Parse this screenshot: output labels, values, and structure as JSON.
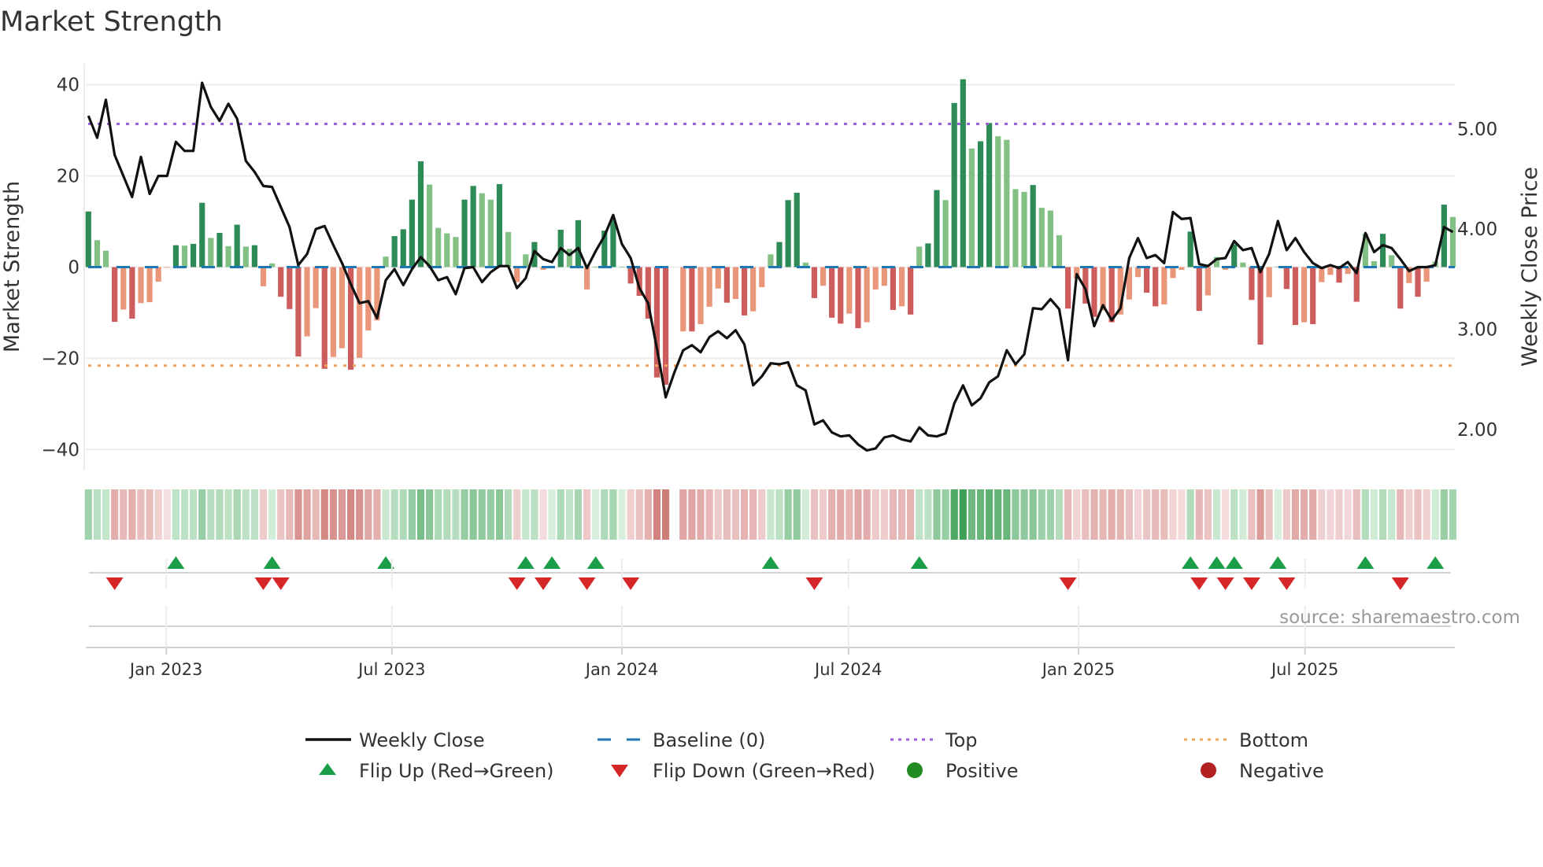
{
  "chart_data": {
    "type": "bar",
    "title": "Market Strength",
    "ylabel": "Market Strength",
    "y2label": "Weekly Close Price",
    "ylim": [
      -44.6,
      44.6
    ],
    "y2lim": [
      1.59,
      5.65
    ],
    "yticks": [
      {
        "v": 40,
        "label": "40"
      },
      {
        "v": 20,
        "label": "20"
      },
      {
        "v": 0,
        "label": "0"
      },
      {
        "v": -20,
        "label": "−20"
      },
      {
        "v": -40,
        "label": "−40"
      }
    ],
    "y2ticks": [
      {
        "v": 5,
        "label": "5.00"
      },
      {
        "v": 4,
        "label": "4.00"
      },
      {
        "v": 3,
        "label": "3.00"
      },
      {
        "v": 2,
        "label": "2.00"
      }
    ],
    "xticks": [
      {
        "week": 8.9,
        "label": "Jan 2023"
      },
      {
        "week": 34.7,
        "label": "Jul 2023"
      },
      {
        "week": 61.0,
        "label": "Jan 2024"
      },
      {
        "week": 86.9,
        "label": "Jul 2024"
      },
      {
        "week": 113.2,
        "label": "Jan 2025"
      },
      {
        "week": 139.1,
        "label": "Jul 2025"
      }
    ],
    "grid": true,
    "levels": {
      "top": 31.4,
      "bottom": -21.6,
      "baseline": 0
    },
    "strength": [
      12.2,
      5.9,
      3.6,
      -12.0,
      -9.3,
      -11.3,
      -7.9,
      -7.7,
      -3.2,
      -0.1,
      4.8,
      4.7,
      5.1,
      14.1,
      6.4,
      7.5,
      4.6,
      9.3,
      4.5,
      4.8,
      -4.2,
      0.8,
      -6.5,
      -9.2,
      -19.6,
      -15.2,
      -9.0,
      -22.3,
      -19.7,
      -17.8,
      -22.5,
      -19.9,
      -13.9,
      -11.7,
      2.3,
      6.8,
      8.3,
      14.8,
      23.2,
      18.1,
      8.6,
      7.4,
      6.6,
      14.8,
      17.8,
      16.2,
      14.8,
      18.2,
      7.7,
      -3.3,
      2.8,
      5.5,
      -0.6,
      0.3,
      8.2,
      4.0,
      10.3,
      -4.9,
      0.1,
      8.0,
      10.5,
      0.1,
      -3.6,
      -6.3,
      -11.3,
      -24.2,
      -25.8,
      null,
      -14.1,
      -14.1,
      -12.5,
      -8.7,
      -4.7,
      -7.8,
      -7.0,
      -10.6,
      -9.7,
      -4.4,
      2.8,
      5.5,
      14.7,
      16.3,
      1.0,
      -6.8,
      -4.1,
      -11.1,
      -12.4,
      -10.2,
      -13.4,
      -12.1,
      -4.9,
      -4.1,
      -9.4,
      -8.6,
      -10.4,
      4.5,
      5.2,
      16.9,
      14.7,
      36.0,
      41.2,
      26.0,
      27.6,
      31.6,
      28.7,
      27.9,
      17.1,
      16.5,
      18.0,
      13.0,
      12.4,
      7.0,
      -9.1,
      -2.5,
      -8.0,
      -10.9,
      -9.5,
      -12.1,
      -10.4,
      -7.1,
      -2.2,
      -5.6,
      -8.6,
      -8.2,
      -2.4,
      -0.6,
      7.8,
      -9.6,
      -6.2,
      2.2,
      -0.6,
      5.0,
      1.0,
      -7.2,
      -17.0,
      -6.6,
      0.1,
      -4.8,
      -12.7,
      -12.1,
      -12.5,
      -3.3,
      -1.7,
      -3.4,
      -1.5,
      -7.6,
      7.3,
      1.3,
      7.3,
      2.6,
      -9.1,
      -3.5,
      -6.5,
      -3.2,
      1.2,
      13.7,
      11.0
    ],
    "close": [
      5.13,
      4.91,
      5.29,
      4.74,
      4.53,
      4.32,
      4.72,
      4.35,
      4.53,
      4.53,
      4.87,
      4.78,
      4.78,
      5.46,
      5.22,
      5.08,
      5.25,
      5.1,
      4.68,
      4.57,
      4.43,
      4.42,
      4.22,
      4.02,
      3.64,
      3.75,
      4.0,
      4.03,
      3.84,
      3.66,
      3.45,
      3.26,
      3.28,
      3.11,
      3.49,
      3.6,
      3.44,
      3.6,
      3.72,
      3.63,
      3.49,
      3.52,
      3.35,
      3.61,
      3.62,
      3.47,
      3.57,
      3.63,
      3.63,
      3.41,
      3.51,
      3.78,
      3.7,
      3.67,
      3.81,
      3.74,
      3.81,
      3.61,
      3.78,
      3.93,
      4.14,
      3.85,
      3.71,
      3.41,
      3.26,
      2.81,
      2.32,
      2.57,
      2.79,
      2.84,
      2.77,
      2.92,
      2.98,
      2.91,
      2.99,
      2.85,
      2.44,
      2.53,
      2.66,
      2.65,
      2.67,
      2.44,
      2.39,
      2.05,
      2.09,
      1.97,
      1.93,
      1.94,
      1.85,
      1.79,
      1.81,
      1.92,
      1.94,
      1.9,
      1.88,
      2.02,
      1.94,
      1.93,
      1.96,
      2.26,
      2.44,
      2.24,
      2.31,
      2.47,
      2.53,
      2.79,
      2.65,
      2.75,
      3.21,
      3.2,
      3.3,
      3.2,
      2.69,
      3.55,
      3.4,
      3.03,
      3.24,
      3.09,
      3.21,
      3.71,
      3.91,
      3.71,
      3.74,
      3.66,
      4.17,
      4.1,
      4.11,
      3.65,
      3.63,
      3.7,
      3.71,
      3.88,
      3.79,
      3.81,
      3.57,
      3.75,
      4.08,
      3.79,
      3.91,
      3.77,
      3.66,
      3.61,
      3.64,
      3.61,
      3.67,
      3.56,
      3.96,
      3.77,
      3.84,
      3.81,
      3.7,
      3.58,
      3.62,
      3.62,
      3.64,
      4.02,
      3.97
    ],
    "legend": {
      "placement": "bottom",
      "items": [
        {
          "label": "Weekly Close",
          "symbol": "line"
        },
        {
          "label": "Baseline (0)",
          "symbol": "dash"
        },
        {
          "label": "Top",
          "symbol": "dot-purple"
        },
        {
          "label": "Bottom",
          "symbol": "dot-orange"
        },
        {
          "label": "Flip Up (Red→Green)",
          "symbol": "triangle-up"
        },
        {
          "label": "Flip Down (Green→Red)",
          "symbol": "triangle-down"
        },
        {
          "label": "Positive",
          "symbol": "circle-green"
        },
        {
          "label": "Negative",
          "symbol": "circle-red"
        }
      ]
    },
    "source": "source: sharemaestro.com",
    "colors": {
      "pos_strong": "#2e8b57",
      "pos_weak": "#82c084",
      "neg_strong": "#cd5c5c",
      "neg_weak": "#e9967a",
      "close": "#111111",
      "baseline": "#1f77b4",
      "top": "#9b5fd6",
      "bottom": "#f0a460",
      "flip_up": "#1a9e48",
      "flip_down": "#d62728",
      "positive": "#228b22",
      "negative": "#b22222",
      "grid": "#ececec"
    }
  }
}
